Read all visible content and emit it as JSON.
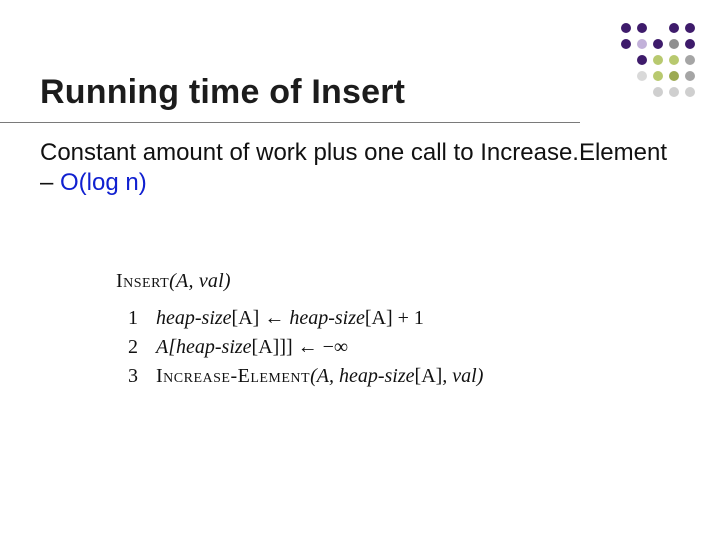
{
  "title": "Running time of Insert",
  "body": {
    "prefix": "Constant amount of work plus one call to Increase.Element – ",
    "complexity": "O(log n)"
  },
  "pseudocode": {
    "header": {
      "fn": "Insert",
      "args": "(A, val)"
    },
    "lines": [
      {
        "n": "1",
        "lhs": "heap-size",
        "lhs_idx": "[A]",
        "arrow": " ← ",
        "rhs": "heap-size",
        "rhs_idx": "[A]",
        "tail": " + 1"
      },
      {
        "n": "2",
        "text_pre": "A[",
        "inner": "heap-size",
        "inner_idx": "[A]",
        "text_mid": "]] ← −∞"
      },
      {
        "n": "3",
        "fn": "Increase-Element",
        "args_pre": "(A, ",
        "arg_name": "heap-size",
        "arg_idx": "[A]",
        "args_post": ", val)"
      }
    ]
  },
  "deco": {
    "colors": [
      [
        "#3e1b6b",
        "#3e1b6b",
        "#ffffff",
        "#3e1b6b",
        "#3e1b6b"
      ],
      [
        "#3e1b6b",
        "#c2b1d9",
        "#3e1b6b",
        "#8f8f8f",
        "#3e1b6b"
      ],
      [
        "#ffffff",
        "#3e1b6b",
        "#b8c96f",
        "#b8c96f",
        "#a5a5a5"
      ],
      [
        "#ffffff",
        "#d9d9d9",
        "#b8c96f",
        "#9caa52",
        "#a5a5a5"
      ],
      [
        "#ffffff",
        "#ffffff",
        "#cfcfcf",
        "#cfcfcf",
        "#cfcfcf"
      ]
    ]
  }
}
